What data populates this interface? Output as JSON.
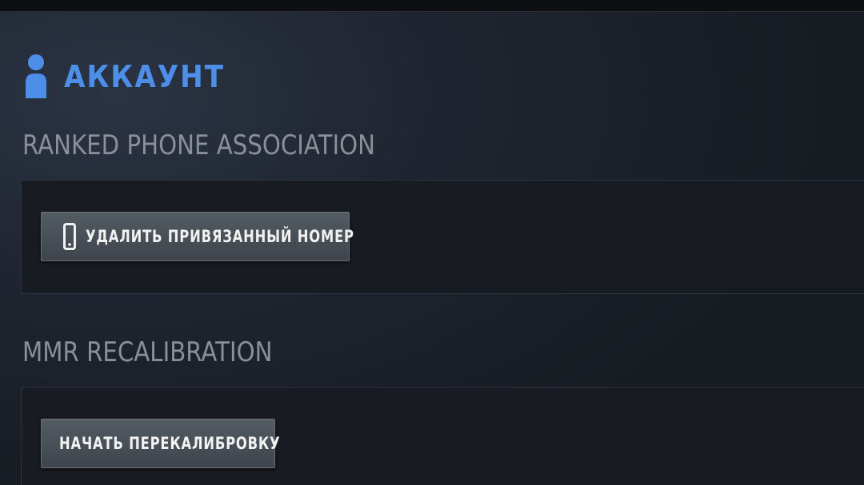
{
  "header": {
    "title": "АККАУНТ",
    "icon": "user-icon",
    "accent_color": "#4d8fe8"
  },
  "sections": [
    {
      "title": "RANKED PHONE ASSOCIATION",
      "button": {
        "label": "УДАЛИТЬ ПРИВЯЗАННЫЙ НОМЕР",
        "icon": "phone-icon"
      }
    },
    {
      "title": "MMR RECALIBRATION",
      "button": {
        "label": "НАЧАТЬ ПЕРЕКАЛИБРОВКУ"
      }
    }
  ]
}
